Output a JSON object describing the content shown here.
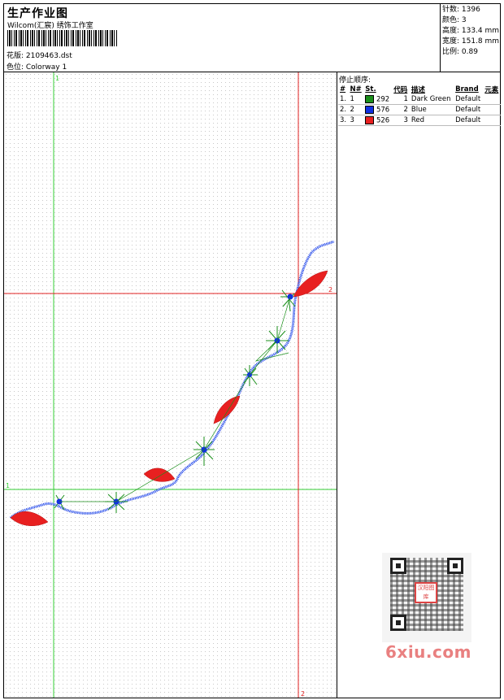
{
  "header": {
    "title": "生产作业图",
    "subtitle": "Wilcom(汇宸) 绣饰工作室",
    "design_label": "花版: 2109463.dst",
    "colorway_label": "色位:  Colorway 1"
  },
  "stats": {
    "stitches": "针数: 1396",
    "colors": "颜色: 3",
    "height": "高度: 133.4 mm",
    "width": "宽度: 151.8 mm",
    "scale": "比例: 0.89"
  },
  "stop_sequence": {
    "title": "停止顺序:",
    "headers": [
      "#",
      "N#",
      "St.",
      "代码",
      "描述",
      "Brand",
      "元素"
    ],
    "rows": [
      {
        "idx": "1.",
        "n": "1",
        "color": "#1a8f1a",
        "st": "292",
        "code": "1",
        "desc": "Dark Green",
        "brand": "Default"
      },
      {
        "idx": "2.",
        "n": "2",
        "color": "#1030e0",
        "st": "576",
        "code": "2",
        "desc": "Blue",
        "brand": "Default"
      },
      {
        "idx": "3.",
        "n": "3",
        "color": "#e82020",
        "st": "526",
        "code": "3",
        "desc": "Red",
        "brand": "Default"
      }
    ]
  },
  "guides": {
    "green_v_label": "1",
    "green_h_label": "1",
    "red_h_label": "2",
    "red_v_label": "2"
  },
  "watermark": {
    "qr_logo": "汉阳图库",
    "site": "6xiu.com"
  }
}
